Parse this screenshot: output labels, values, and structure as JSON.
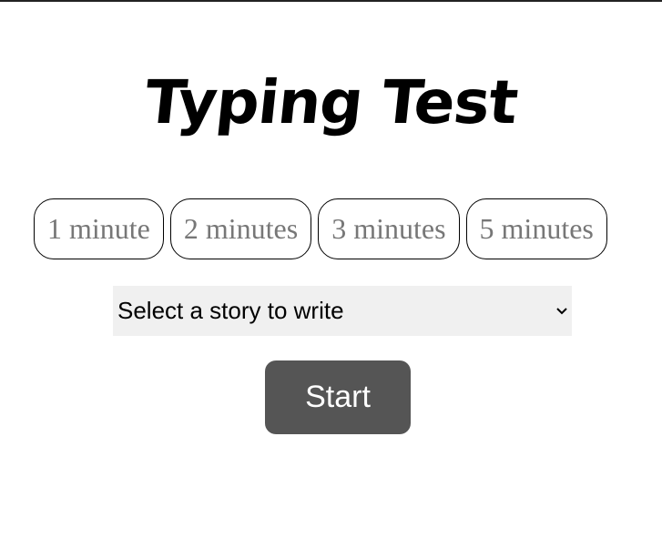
{
  "page": {
    "title": "Typing Test"
  },
  "durations": [
    {
      "label": "1 minute"
    },
    {
      "label": "2 minutes"
    },
    {
      "label": "3 minutes"
    },
    {
      "label": "5 minutes"
    }
  ],
  "story_select": {
    "selected": "Select a story to write",
    "icon": "chevron-down-icon"
  },
  "start_button": {
    "label": "Start"
  },
  "colors": {
    "start_button_bg": "#555555",
    "select_bg": "#f0f0f0",
    "duration_text": "#777777"
  }
}
